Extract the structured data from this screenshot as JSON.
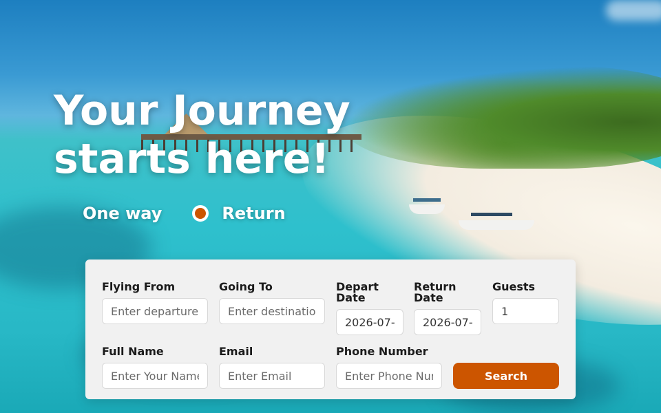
{
  "hero": {
    "title_line1": "Your Journey",
    "title_line2": "starts here!"
  },
  "trip_type": {
    "one_way": "One way",
    "return": "Return",
    "selected": "Return"
  },
  "form": {
    "flying_from": {
      "label": "Flying From",
      "placeholder": "Enter departure city"
    },
    "going_to": {
      "label": "Going To",
      "placeholder": "Enter destination city"
    },
    "depart_date": {
      "label": "Depart Date",
      "value": "2026-07-"
    },
    "return_date": {
      "label": "Return Date",
      "value": "2026-07-"
    },
    "guests": {
      "label": "Guests",
      "value": "1"
    },
    "full_name": {
      "label": "Full Name",
      "placeholder": "Enter Your Name"
    },
    "email": {
      "label": "Email",
      "placeholder": "Enter Email"
    },
    "phone": {
      "label": "Phone Number",
      "placeholder": "Enter Phone Number"
    },
    "search_label": "Search"
  },
  "colors": {
    "accent": "#cc5500",
    "card_bg": "#f1f1f1",
    "text": "#1b1b1b"
  }
}
